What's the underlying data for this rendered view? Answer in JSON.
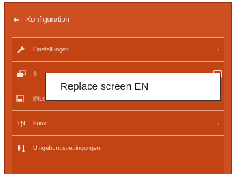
{
  "header": {
    "title": "Konfiguration",
    "back_icon": "arrow-left-icon"
  },
  "menu": {
    "items": [
      {
        "label": "Einstellungen",
        "icon": "wrench-icon",
        "has_chevron": true
      },
      {
        "label": "S",
        "icon": "screens-icon",
        "has_chevron": false
      },
      {
        "label": "iPlus speichern",
        "icon": "save-device-icon",
        "has_chevron": false
      },
      {
        "label": "Funk",
        "icon": "radio-icon",
        "has_chevron": true
      },
      {
        "label": "Umgebungsbedingungen",
        "icon": "environment-icon",
        "has_chevron": false
      }
    ]
  },
  "overlay": {
    "text": "Replace screen EN"
  },
  "colors": {
    "background": "#ce4f20",
    "menu_background": "#c24413",
    "divider": "#e8a383",
    "text": "#f6d6c6",
    "overlay_background": "#ffffff"
  }
}
